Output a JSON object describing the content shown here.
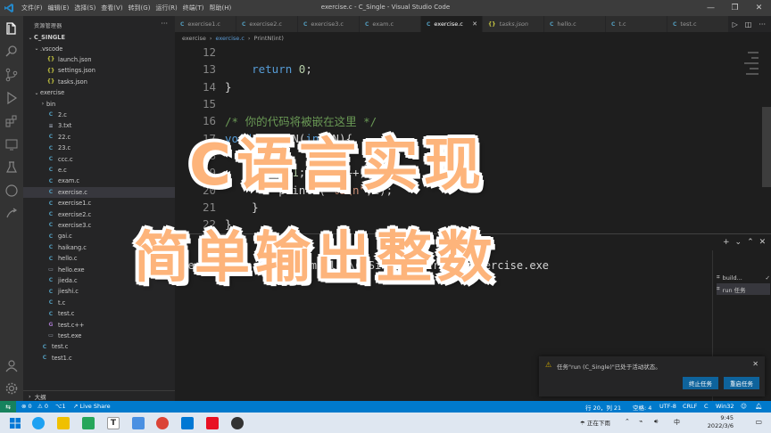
{
  "titlebar": {
    "title": "exercise.c - C_Single - Visual Studio Code",
    "menu": [
      "文件(F)",
      "编辑(E)",
      "选择(S)",
      "查看(V)",
      "转到(G)",
      "运行(R)",
      "终端(T)",
      "帮助(H)"
    ],
    "controls": [
      "—",
      "❐",
      "✕"
    ]
  },
  "sidebar": {
    "title": "资源管理器",
    "more": "···",
    "tree": [
      {
        "label": "C_SINGLE",
        "level": 0,
        "chev": "⌄",
        "icon": ""
      },
      {
        "label": ".vscode",
        "level": 1,
        "chev": "⌄",
        "icon": ""
      },
      {
        "label": "launch.json",
        "level": 2,
        "chev": "",
        "icon": "{}"
      },
      {
        "label": "settings.json",
        "level": 2,
        "chev": "",
        "icon": "{}"
      },
      {
        "label": "tasks.json",
        "level": 2,
        "chev": "",
        "icon": "{}"
      },
      {
        "label": "exercise",
        "level": 1,
        "chev": "⌄",
        "icon": ""
      },
      {
        "label": "bin",
        "level": 2,
        "chev": "›",
        "icon": ""
      },
      {
        "label": "2.c",
        "level": 2,
        "chev": "",
        "icon": "C"
      },
      {
        "label": "3.txt",
        "level": 2,
        "chev": "",
        "icon": "≡"
      },
      {
        "label": "22.c",
        "level": 2,
        "chev": "",
        "icon": "C"
      },
      {
        "label": "23.c",
        "level": 2,
        "chev": "",
        "icon": "C"
      },
      {
        "label": "ccc.c",
        "level": 2,
        "chev": "",
        "icon": "C"
      },
      {
        "label": "e.c",
        "level": 2,
        "chev": "",
        "icon": "C"
      },
      {
        "label": "exam.c",
        "level": 2,
        "chev": "",
        "icon": "C"
      },
      {
        "label": "exercise.c",
        "level": 2,
        "chev": "",
        "icon": "C",
        "selected": true
      },
      {
        "label": "exercise1.c",
        "level": 2,
        "chev": "",
        "icon": "C"
      },
      {
        "label": "exercise2.c",
        "level": 2,
        "chev": "",
        "icon": "C"
      },
      {
        "label": "exercise3.c",
        "level": 2,
        "chev": "",
        "icon": "C"
      },
      {
        "label": "gai.c",
        "level": 2,
        "chev": "",
        "icon": "C"
      },
      {
        "label": "haikang.c",
        "level": 2,
        "chev": "",
        "icon": "C"
      },
      {
        "label": "hello.c",
        "level": 2,
        "chev": "",
        "icon": "C"
      },
      {
        "label": "hello.exe",
        "level": 2,
        "chev": "",
        "icon": "▭"
      },
      {
        "label": "jieda.c",
        "level": 2,
        "chev": "",
        "icon": "C"
      },
      {
        "label": "jieshi.c",
        "level": 2,
        "chev": "",
        "icon": "C"
      },
      {
        "label": "t.c",
        "level": 2,
        "chev": "",
        "icon": "C"
      },
      {
        "label": "test.c",
        "level": 2,
        "chev": "",
        "icon": "C"
      },
      {
        "label": "test.c++",
        "level": 2,
        "chev": "",
        "icon": "G"
      },
      {
        "label": "test.exe",
        "level": 2,
        "chev": "",
        "icon": "▭"
      },
      {
        "label": "test.c",
        "level": 1,
        "chev": "",
        "icon": "C"
      },
      {
        "label": "test1.c",
        "level": 1,
        "chev": "",
        "icon": "C"
      }
    ],
    "outline": "大纲"
  },
  "tabs": [
    {
      "label": "exercise1.c",
      "icon": "C",
      "active": false
    },
    {
      "label": "exercise2.c",
      "icon": "C",
      "active": false
    },
    {
      "label": "exercise3.c",
      "icon": "C",
      "active": false
    },
    {
      "label": "exam.c",
      "icon": "C",
      "active": false
    },
    {
      "label": "exercise.c",
      "icon": "C",
      "active": true
    },
    {
      "label": "tasks.json",
      "icon": "{}",
      "active": false
    },
    {
      "label": "hello.c",
      "icon": "C",
      "active": false
    },
    {
      "label": "t.c",
      "icon": "C",
      "active": false
    },
    {
      "label": "test.c",
      "icon": "C",
      "active": false
    }
  ],
  "breadcrumb": [
    "exercise",
    "›",
    "exercise.c",
    "›",
    "PrintN(int)"
  ],
  "code": {
    "lines": [
      {
        "n": "12",
        "html": ""
      },
      {
        "n": "13",
        "html": "    <span class='kw'>return</span> <span class='num'>0</span>;"
      },
      {
        "n": "14",
        "html": "}"
      },
      {
        "n": "15",
        "html": ""
      },
      {
        "n": "16",
        "html": "<span class='cmt'>/* 你的代码将被嵌在这里 */</span>"
      },
      {
        "n": "17",
        "html": "<span class='kw'>void</span> PrintN(<span class='kw'>int</span> N){"
      },
      {
        "n": "18",
        "html": "    <span class='kw'>int</span> i;"
      },
      {
        "n": "19",
        "html": "    <span class='kw'>for</span>(i=<span class='num'>1</span>;i&lt;=N;i++){"
      },
      {
        "n": "20",
        "html": "        printf(<span class='str'>\"%d\\n\"</span>,i);"
      },
      {
        "n": "21",
        "html": "    }"
      },
      {
        "n": "22",
        "html": "}"
      }
    ]
  },
  "panel": {
    "tab": "输出",
    "terminal": "Executing task: C:\\Compiler\\C_Single\\exercise\\exercise.exe",
    "tasks": [
      "build...",
      "run 任务"
    ]
  },
  "notification": {
    "message": "任务\"run (C_Single)\"已处于活动状态。",
    "buttons": [
      "终止任务",
      "重启任务"
    ]
  },
  "statusbar": {
    "left": [
      "⊗ 0",
      "⚠ 0",
      "⌥1",
      "Live Share"
    ],
    "position": "行 20，列 21",
    "spaces": "空格: 4",
    "encoding": "UTF-8",
    "eol": "CRLF",
    "lang": "C",
    "platform": "Win32"
  },
  "taskbar": {
    "weather": "正在下雨",
    "ime": "中",
    "time": "9:45",
    "date": "2022/3/6"
  },
  "overlay": {
    "line1": "C语言实现",
    "line2": "简单输出整数"
  }
}
